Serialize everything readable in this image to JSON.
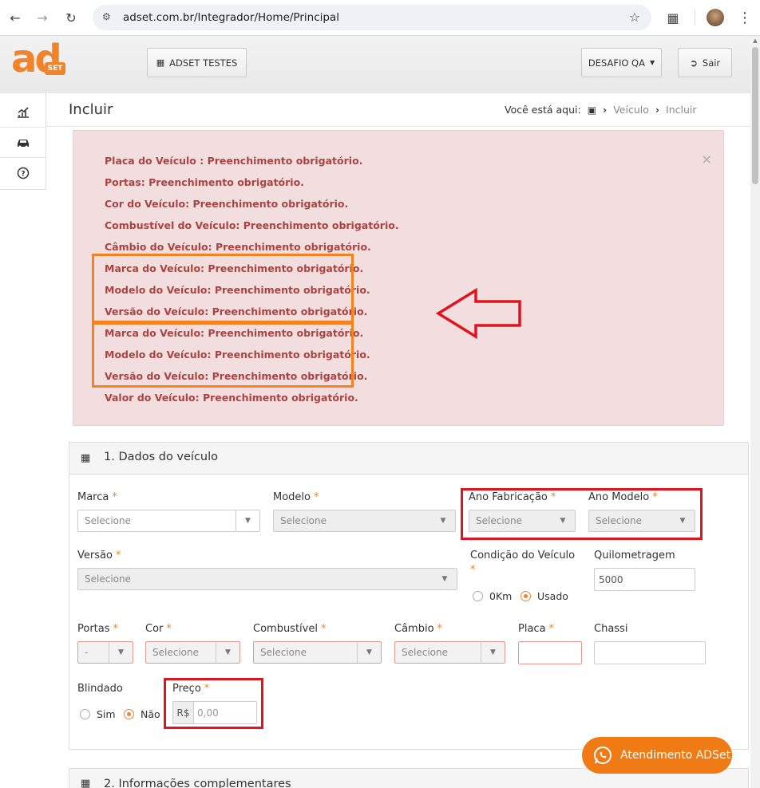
{
  "browser": {
    "url": "adset.com.br/Integrador/Home/Principal"
  },
  "header": {
    "logo_text": "ad",
    "logo_sub": "SET",
    "company_button": "ADSET TESTES",
    "user_menu": "DESAFIO QA",
    "logout": "Sair"
  },
  "page": {
    "title": "Incluir",
    "breadcrumb_prefix": "Você está aqui:",
    "breadcrumb_1": "Veículo",
    "breadcrumb_2": "Incluir"
  },
  "alert": {
    "close": "×",
    "errors": [
      "Placa do Veículo : Preenchimento obrigatório.",
      "Portas: Preenchimento obrigatório.",
      "Cor do Veículo: Preenchimento obrigatório.",
      "Combustível do Veículo: Preenchimento obrigatório.",
      "Câmbio do Veículo: Preenchimento obrigatório.",
      "Marca do Veículo: Preenchimento obrigatório.",
      "Modelo do Veículo: Preenchimento obrigatório.",
      "Versão do Veículo: Preenchimento obrigatório.",
      "Marca do Veículo: Preenchimento obrigatório.",
      "Modelo do Veículo: Preenchimento obrigatório.",
      "Versão do Veículo: Preenchimento obrigatório.",
      "Valor do Veículo: Preenchimento obrigatório."
    ]
  },
  "section1": {
    "title": "1. Dados do veículo",
    "required_mark": "*",
    "marca": {
      "label": "Marca",
      "value": "Selecione"
    },
    "modelo": {
      "label": "Modelo",
      "value": "Selecione"
    },
    "ano_fabricacao": {
      "label": "Ano Fabricação",
      "value": "Selecione"
    },
    "ano_modelo": {
      "label": "Ano Modelo",
      "value": "Selecione"
    },
    "versao": {
      "label": "Versão",
      "value": "Selecione"
    },
    "condicao": {
      "label": "Condição do Veículo",
      "opt_0km": "0Km",
      "opt_usado": "Usado",
      "selected": "Usado"
    },
    "quilometragem": {
      "label": "Quilometragem",
      "value": "5000"
    },
    "portas": {
      "label": "Portas",
      "value": "-"
    },
    "cor": {
      "label": "Cor",
      "value": "Selecione"
    },
    "combustivel": {
      "label": "Combustível",
      "value": "Selecione"
    },
    "cambio": {
      "label": "Câmbio",
      "value": "Selecione"
    },
    "placa": {
      "label": "Placa",
      "value": ""
    },
    "chassi": {
      "label": "Chassi",
      "value": ""
    },
    "blindado": {
      "label": "Blindado",
      "opt_sim": "Sim",
      "opt_nao": "Não",
      "selected": "Não"
    },
    "preco": {
      "label": "Preço",
      "prefix": "R$",
      "placeholder": "0,00"
    }
  },
  "section2": {
    "title": "2. Informações complementares"
  },
  "chat": {
    "label": "Atendimento ADSet"
  },
  "colors": {
    "accent": "#f0842c",
    "error_text": "#a94442",
    "error_bg": "#f2dede",
    "highlight_red": "#e0141e",
    "highlight_orange": "#f5821f"
  }
}
